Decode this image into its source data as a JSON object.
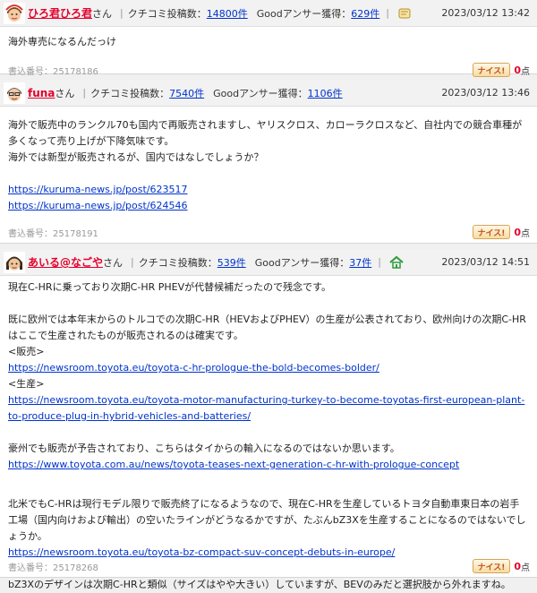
{
  "labels": {
    "kuchikomi": "クチコミ投稿数：",
    "good_answer": "Goodアンサー獲得：",
    "san": "さん",
    "postno_prefix": "書込番号：",
    "nice": "ナイス!",
    "nice_unit": "点"
  },
  "posts": [
    {
      "user": "ひろ君ひろ君",
      "kuchikomi": "14800件",
      "good": "629件",
      "date": "2023/03/12 13:42",
      "badge_icon": "scroll-badge-icon",
      "paragraphs": [
        "海外専売になるんだっけ"
      ],
      "postno": "25178186",
      "nice_count": "0"
    },
    {
      "user": "funa",
      "kuchikomi": "7540件",
      "good": "1106件",
      "date": "2023/03/12 13:46",
      "paragraphs": [
        "海外で販売中のランクル70も国内で再販売されますし、ヤリスクロス、カローラクロスなど、自社内での競合車種が多くなって売り上げが下降気味です。",
        "海外では新型が販売されるが、国内ではなしでしょうか？"
      ],
      "links": [
        "https://kuruma-news.jp/post/623517",
        "https://kuruma-news.jp/post/624546"
      ],
      "postno": "25178191",
      "nice_count": "0"
    },
    {
      "user": "あいる@なごや",
      "kuchikomi": "539件",
      "good": "37件",
      "date": "2023/03/12 14:51",
      "badge_icon": "house-badge-icon",
      "text": {
        "t1": "現在C-HRに乗っており次期C-HR PHEVが代替候補だったので残念です。",
        "t2": "既に欧州では本年末からのトルコでの次期C-HR（HEVおよびPHEV）の生産が公表されており、欧州向けの次期C-HRはここで生産されたものが販売されるのは確実です。",
        "t3": "<販売>",
        "l1": "https://newsroom.toyota.eu/toyota-c-hr-prologue-the-bold-becomes-bolder/",
        "t4": "<生産>",
        "l2": "https://newsroom.toyota.eu/toyota-motor-manufacturing-turkey-to-become-toyotas-first-european-plant-to-produce-plug-in-hybrid-vehicles-and-batteries/",
        "t5": "豪州でも販売が予告されており、こちらはタイからの輸入になるのではないか思います。",
        "l3": "https://www.toyota.com.au/news/toyota-teases-next-generation-c-hr-with-prologue-concept",
        "t6": "北米でもC-HRは現行モデル限りで販売終了になるようなので、現在C-HRを生産しているトヨタ自動車東日本の岩手工場（国内向けおよび輸出）の空いたラインがどうなるかですが、たぶんbZ3Xを生産することになるのではないでしょうか。",
        "l4": "https://newsroom.toyota.eu/toyota-bz-compact-suv-concept-debuts-in-europe/",
        "t7": "bZ3Xのデザインは次期C-HRと類似（サイズはやや大きい）していますが、BEVのみだと選択肢から外れますね。"
      },
      "postno": "25178268",
      "nice_count": "0"
    }
  ]
}
